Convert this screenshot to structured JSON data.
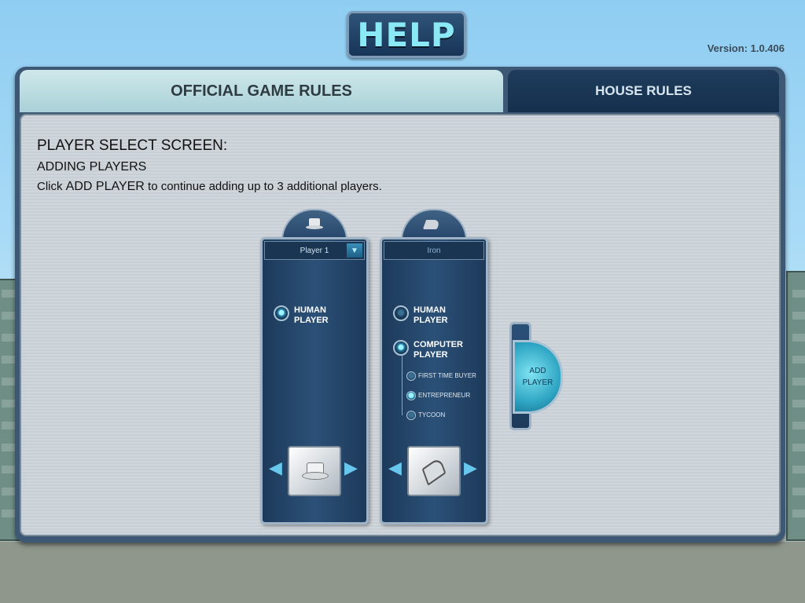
{
  "title": "HELP",
  "version": "Version: 1.0.406",
  "tabs": {
    "official": "OFFICIAL GAME RULES",
    "house": "HOUSE RULES"
  },
  "rules": {
    "heading": "PLAYER SELECT SCREEN:",
    "subheading": "ADDING PLAYERS",
    "text_prefix": "Click ",
    "text_bold": "ADD PLAYER",
    "text_suffix": " to continue adding up to 3 additional players."
  },
  "player_cards": [
    {
      "name": "Player 1",
      "token_icon": "top-hat-icon",
      "options": [
        {
          "label_line1": "HUMAN",
          "label_line2": "PLAYER",
          "selected": true
        }
      ]
    },
    {
      "name": "Iron",
      "token_icon": "iron-icon",
      "options": [
        {
          "label_line1": "HUMAN",
          "label_line2": "PLAYER",
          "selected": false
        },
        {
          "label_line1": "COMPUTER",
          "label_line2": "PLAYER",
          "selected": true
        }
      ],
      "difficulty": [
        {
          "label": "FIRST TIME BUYER",
          "selected": false
        },
        {
          "label": "ENTREPRENEUR",
          "selected": true
        },
        {
          "label": "TYCOON",
          "selected": false
        }
      ]
    }
  ],
  "add_player": {
    "line1": "ADD",
    "line2": "PLAYER"
  },
  "colors": {
    "panel": "#3c5874",
    "accent": "#67c7ec",
    "title_text": "#8be9f5"
  }
}
